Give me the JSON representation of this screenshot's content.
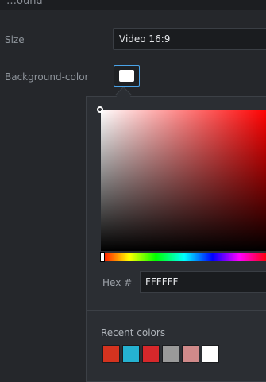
{
  "header": {
    "partial_title": "…ound"
  },
  "settings": {
    "size_label": "Size",
    "size_value": "Video 16:9",
    "background_label": "Background-color",
    "background_value": "#FFFFFF"
  },
  "picker": {
    "hex_label": "Hex #",
    "hex_value": "FFFFFF",
    "recent_label": "Recent colors",
    "recent_colors": [
      "#d4331f",
      "#25b2d1",
      "#d6282b",
      "#9a9a9a",
      "#d08a8a",
      "#ffffff"
    ]
  }
}
